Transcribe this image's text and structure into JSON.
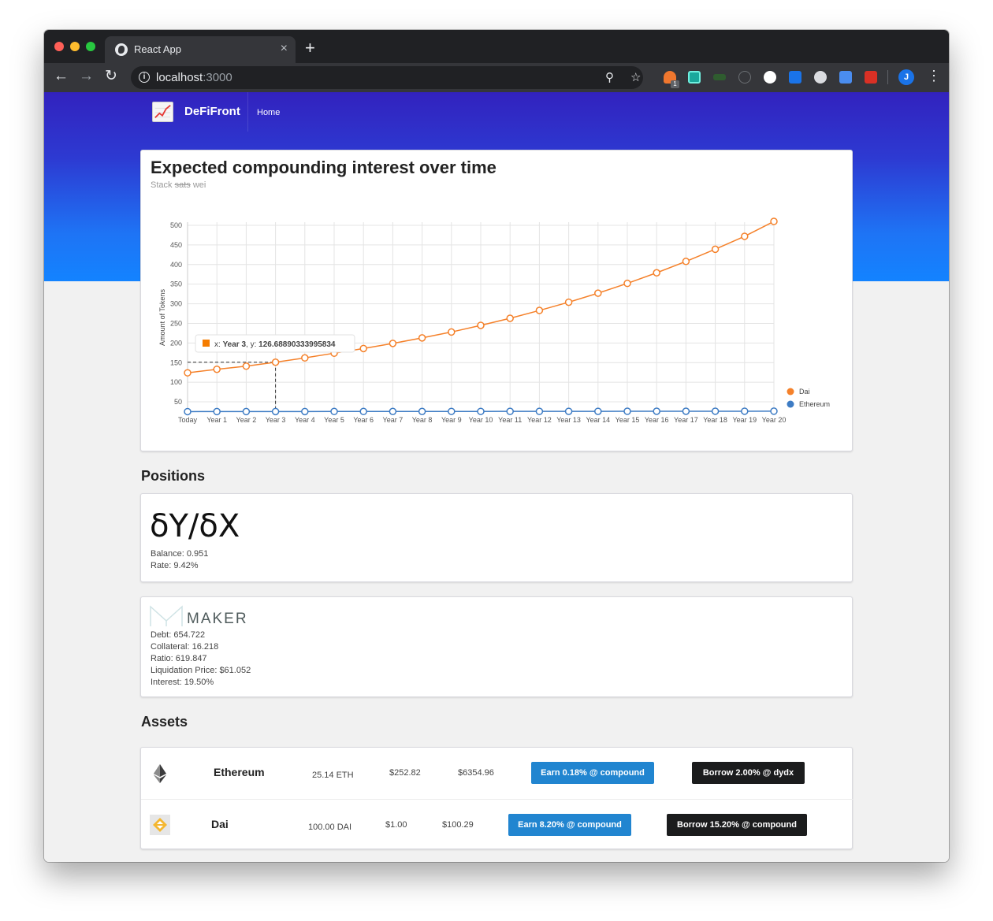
{
  "browser": {
    "tab_title": "React App",
    "tab_close": "×",
    "new_tab": "+",
    "url_host": "localhost",
    "url_port": ":3000",
    "info": "i",
    "profile_initial": "J",
    "ext_badge": "1"
  },
  "app": {
    "brand": "DeFiFront",
    "nav_home": "Home"
  },
  "chart_card": {
    "title": "Expected compounding interest over time",
    "subtitle_prefix": "Stack ",
    "subtitle_struck": "sats",
    "subtitle_suffix": " wei"
  },
  "chart_data": {
    "type": "line",
    "ylabel": "Amount of Tokens",
    "ylim": [
      30,
      510
    ],
    "yticks": [
      50,
      100,
      150,
      200,
      250,
      300,
      350,
      400,
      450,
      500
    ],
    "categories": [
      "Today",
      "Year 1",
      "Year 2",
      "Year 3",
      "Year 4",
      "Year 5",
      "Year 6",
      "Year 7",
      "Year 8",
      "Year 9",
      "Year 10",
      "Year 11",
      "Year 12",
      "Year 13",
      "Year 14",
      "Year 15",
      "Year 16",
      "Year 17",
      "Year 18",
      "Year 19",
      "Year 20"
    ],
    "series": [
      {
        "name": "Dai",
        "color": "#f5812a",
        "values": [
          124,
          133,
          141,
          151,
          162,
          174,
          186,
          199,
          213,
          228,
          245,
          263,
          283,
          304,
          327,
          352,
          379,
          408,
          439,
          472,
          510
        ]
      },
      {
        "name": "Ethereum",
        "color": "#3e7cc4",
        "values": [
          25.1,
          25.2,
          25.2,
          25.3,
          25.3,
          25.4,
          25.4,
          25.5,
          25.5,
          25.6,
          25.6,
          25.7,
          25.7,
          25.8,
          25.8,
          25.9,
          26.0,
          26.0,
          26.1,
          26.1,
          26.2
        ]
      }
    ],
    "legend_position": "right",
    "grid": true,
    "tooltip": {
      "series": "Dai",
      "index": 3,
      "x_label": "x: ",
      "x_value": "Year 3",
      "y_label": ", y: ",
      "y_value": "126.68890333995834"
    }
  },
  "positions": {
    "title": "Positions",
    "dydx": {
      "logo_text": "δY/δX",
      "balance": "Balance: 0.951",
      "rate": "Rate: 9.42%"
    },
    "maker": {
      "logo_text": "MAKER",
      "debt": "Debt: 654.722",
      "collateral": "Collateral: 16.218",
      "ratio": "Ratio: 619.847",
      "liquidation": "Liquidation Price: $61.052",
      "interest": "Interest: 19.50%"
    }
  },
  "assets": {
    "title": "Assets",
    "rows": [
      {
        "name": "Ethereum",
        "icon": "ethereum-icon",
        "amount": "25.14 ETH",
        "price": "$252.82",
        "value": "$6354.96",
        "earn": "Earn 0.18% @ compound",
        "borrow": "Borrow 2.00% @ dydx"
      },
      {
        "name": "Dai",
        "icon": "dai-icon",
        "amount": "100.00 DAI",
        "price": "$1.00",
        "value": "$100.29",
        "earn": "Earn 8.20% @ compound",
        "borrow": "Borrow 15.20% @ compound"
      }
    ]
  }
}
